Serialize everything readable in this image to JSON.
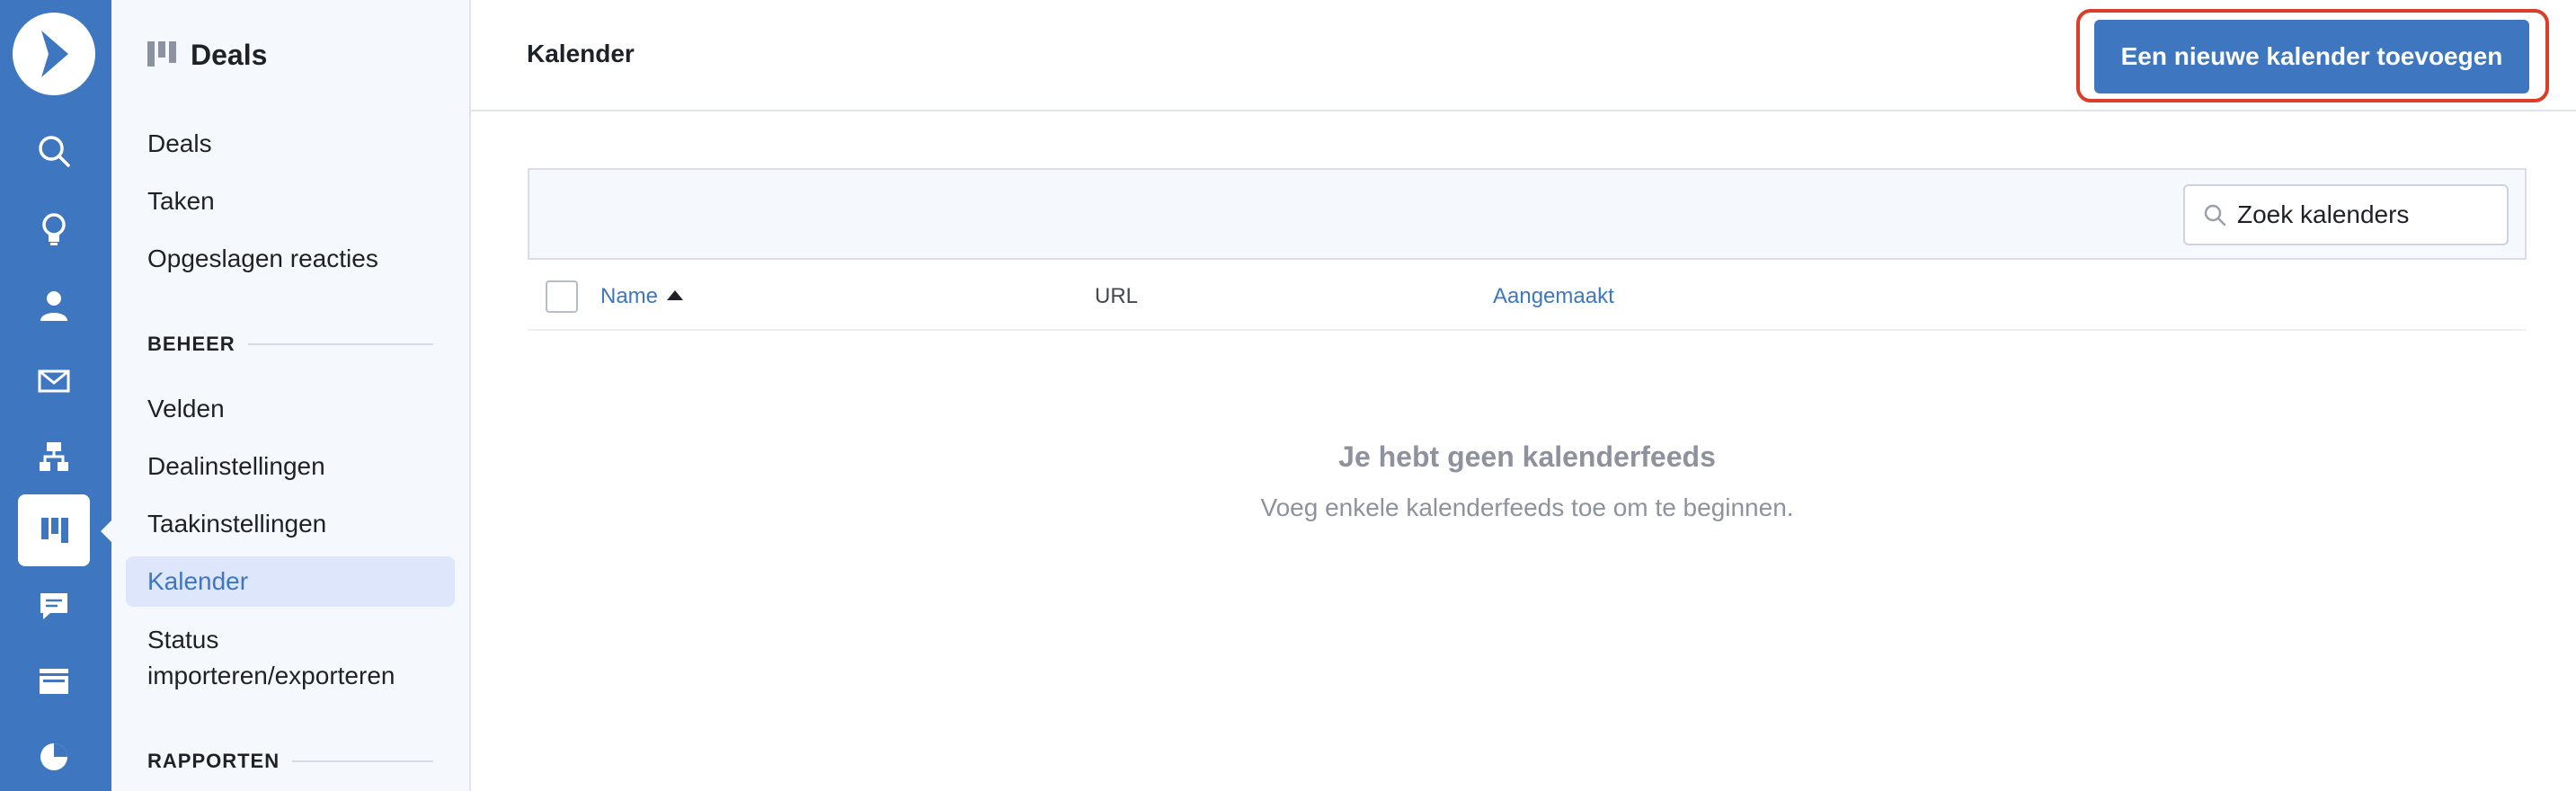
{
  "rail": {
    "items": [
      {
        "icon": "search-icon"
      },
      {
        "icon": "lightbulb-icon"
      },
      {
        "icon": "contacts-icon"
      },
      {
        "icon": "mail-icon"
      },
      {
        "icon": "automation-icon"
      },
      {
        "icon": "deals-icon",
        "active": true
      },
      {
        "icon": "chat-icon"
      },
      {
        "icon": "site-icon"
      },
      {
        "icon": "reports-icon"
      }
    ],
    "accent": "#3e77c0"
  },
  "sidebar": {
    "title": "Deals",
    "items": [
      {
        "label": "Deals"
      },
      {
        "label": "Taken"
      },
      {
        "label": "Opgeslagen reacties"
      }
    ],
    "section_beheer": "BEHEER",
    "beheer_items": [
      {
        "label": "Velden"
      },
      {
        "label": "Dealinstellingen"
      },
      {
        "label": "Taakinstellingen"
      },
      {
        "label": "Kalender",
        "active": true
      },
      {
        "label_line1": "Status",
        "label_line2": "importeren/exporteren"
      }
    ],
    "section_rapporten": "RAPPORTEN"
  },
  "header": {
    "title": "Kalender",
    "add_button": "Een nieuwe kalender toevoegen",
    "highlight_color": "#dc3c28"
  },
  "search": {
    "placeholder": "Zoek kalenders"
  },
  "table": {
    "columns": {
      "name": "Name",
      "url": "URL",
      "created": "Aangemaakt"
    }
  },
  "empty": {
    "heading": "Je hebt geen kalenderfeeds",
    "text": "Voeg enkele kalenderfeeds toe om te beginnen."
  }
}
